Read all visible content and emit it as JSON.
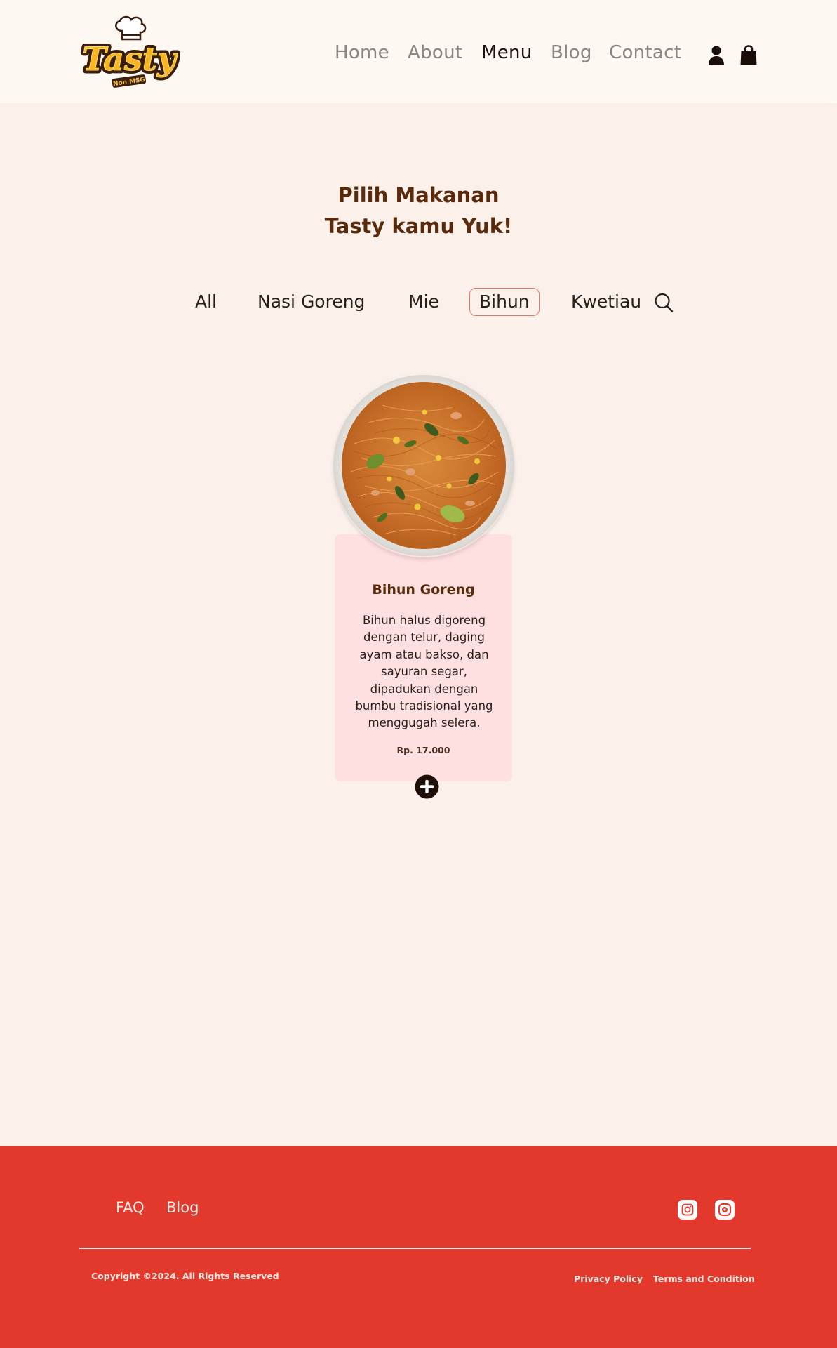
{
  "header": {
    "logo": {
      "text": "Tasty",
      "tagline": "Non MSG",
      "icon": "chef-hat-icon"
    },
    "nav": [
      {
        "label": "Home",
        "active": false
      },
      {
        "label": "About",
        "active": false
      },
      {
        "label": "Menu",
        "active": true
      },
      {
        "label": "Blog",
        "active": false
      },
      {
        "label": "Contact",
        "active": false
      }
    ],
    "icons": [
      "user-icon",
      "shopping-bag-icon"
    ]
  },
  "hero": {
    "title_line1": "Pilih Makanan",
    "title_line2": "Tasty kamu Yuk!"
  },
  "filters": {
    "tabs": [
      {
        "label": "All",
        "active": false
      },
      {
        "label": "Nasi Goreng",
        "active": false
      },
      {
        "label": "Mie",
        "active": false
      },
      {
        "label": "Bihun",
        "active": true
      },
      {
        "label": "Kwetiau",
        "active": false
      }
    ],
    "search_icon": "search-icon"
  },
  "products": [
    {
      "name": "Bihun Goreng",
      "description": "Bihun halus digoreng dengan telur, daging ayam atau bakso, dan sayuran segar, dipadukan dengan bumbu tradisional yang menggugah selera.",
      "price": "Rp. 17.000",
      "add_icon": "plus-circle-icon"
    }
  ],
  "footer": {
    "links": [
      {
        "label": "FAQ"
      },
      {
        "label": "Blog"
      }
    ],
    "social": [
      "instagram-icon",
      "instagram-alt-icon"
    ],
    "copyright": "Copyright ©2024. All Rights Reserved",
    "legal": [
      {
        "label": "Privacy Policy"
      },
      {
        "label": "Terms and Condition"
      }
    ]
  },
  "colors": {
    "page_bg": "#FBF1EA",
    "header_bg": "#FEF8F3",
    "title_brown": "#5A2A0C",
    "card_pink": "#FFE0E0",
    "active_tab_border": "#E8776A",
    "footer_red": "#E2392C"
  }
}
